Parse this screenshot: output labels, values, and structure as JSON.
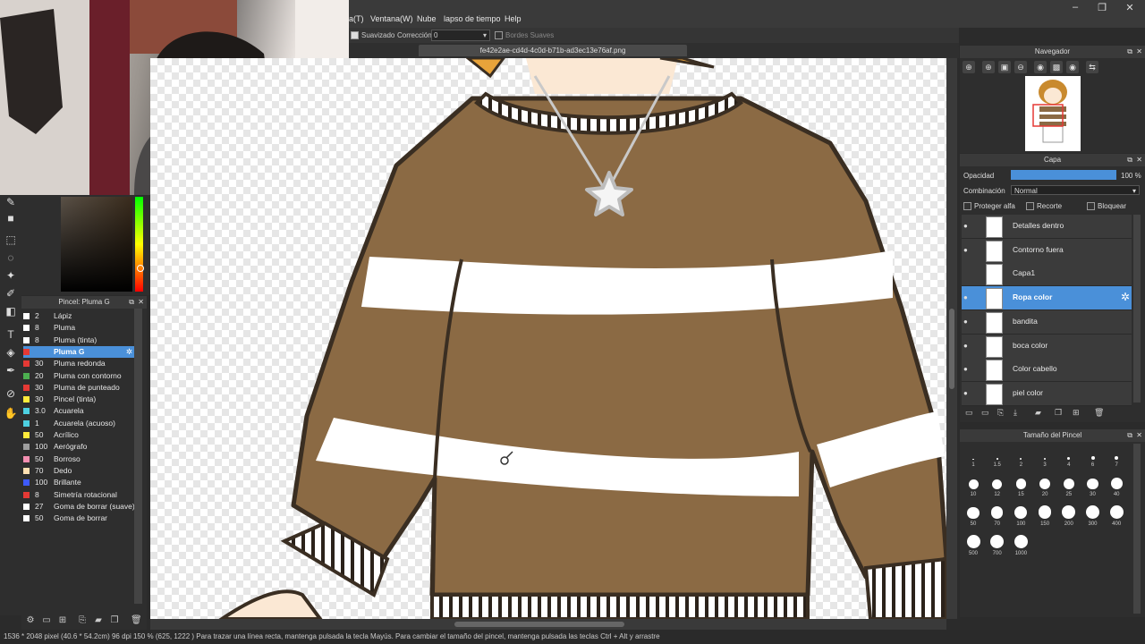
{
  "menu": {
    "items": [
      "a(T)",
      "Ventana(W)",
      "Nube",
      "lapso de tiempo",
      "Help"
    ]
  },
  "window_controls": {
    "minimize": "–",
    "restore": "❐",
    "close": "✕"
  },
  "tool_options": {
    "smoothing_label": "Suavizado",
    "correction_label": "Corrección",
    "correction_value": "0",
    "soft_edges_label": "Bordes Suaves"
  },
  "document": {
    "tab_title": "fe42e2ae-cd4d-4c0d-b71b-ad3ec13e76af.png"
  },
  "brush_panel": {
    "title": "Pincel: Pluma G",
    "brushes": [
      {
        "size": "2",
        "name": "Lápiz",
        "color": "#ffffff"
      },
      {
        "size": "8",
        "name": "Pluma",
        "color": "#ffffff"
      },
      {
        "size": "8",
        "name": "Pluma (tinta)",
        "color": "#ffffff"
      },
      {
        "size": "",
        "name": "Pluma G",
        "color": "#e53935"
      },
      {
        "size": "30",
        "name": "Pluma redonda",
        "color": "#e53935"
      },
      {
        "size": "20",
        "name": "Pluma con contorno",
        "color": "#4caf50"
      },
      {
        "size": "30",
        "name": "Pluma de punteado",
        "color": "#e53935"
      },
      {
        "size": "30",
        "name": "Pincel (tinta)",
        "color": "#ffeb3b"
      },
      {
        "size": "3.0",
        "name": "Acuarela",
        "color": "#4dd0e1"
      },
      {
        "size": "1",
        "name": "Acuarela (acuoso)",
        "color": "#4dd0e1"
      },
      {
        "size": "50",
        "name": "Acrílico",
        "color": "#ffeb3b"
      },
      {
        "size": "100",
        "name": "Aerógrafo",
        "color": "#9e9e9e"
      },
      {
        "size": "50",
        "name": "Borroso",
        "color": "#f48fb1"
      },
      {
        "size": "70",
        "name": "Dedo",
        "color": "#ffe0b2"
      },
      {
        "size": "100",
        "name": "Brillante",
        "color": "#3d5afe"
      },
      {
        "size": "8",
        "name": "Simetría rotacional",
        "color": "#e53935"
      },
      {
        "size": "27",
        "name": "Goma de borrar (suave)",
        "color": "#ffffff"
      },
      {
        "size": "50",
        "name": "Goma de borrar",
        "color": "#ffffff"
      }
    ]
  },
  "navigator": {
    "title": "Navegador"
  },
  "layers": {
    "title": "Capa",
    "opacity_label": "Opacidad",
    "opacity_value": "100 %",
    "opacity_fraction": 1.0,
    "blend_label": "Combinación",
    "blend_value": "Normal",
    "protect_alpha": "Proteger alfa",
    "clipping": "Recorte",
    "lock": "Bloquear",
    "items": [
      {
        "name": "Detalles dentro",
        "visible": true,
        "selected": false
      },
      {
        "name": "Contorno fuera",
        "visible": true,
        "selected": false
      },
      {
        "name": "Capa1",
        "visible": false,
        "selected": false
      },
      {
        "name": "Ropa color",
        "visible": true,
        "selected": true
      },
      {
        "name": "bandita",
        "visible": true,
        "selected": false
      },
      {
        "name": "boca color",
        "visible": true,
        "selected": false
      },
      {
        "name": "Color cabello",
        "visible": true,
        "selected": false
      },
      {
        "name": "piel color",
        "visible": true,
        "selected": false
      }
    ]
  },
  "brush_size": {
    "title": "Tamaño del Pincel",
    "sizes": [
      "1",
      "1.5",
      "2",
      "3",
      "4",
      "6",
      "7",
      "10",
      "12",
      "15",
      "20",
      "25",
      "30",
      "40",
      "50",
      "70",
      "100",
      "150",
      "200",
      "300",
      "400",
      "500",
      "700",
      "1000"
    ]
  },
  "status": {
    "text": "1536 * 2048 pixel   (40.6 * 54.2cm)   96 dpi   150 %   (625, 1222 )   Para trazar una línea recta, mantenga pulsada la tecla Mayús. Para cambiar el tamaño del pincel, mantenga pulsada las teclas Ctrl + Alt y arrastre"
  },
  "colors": {
    "accent": "#4a90d9",
    "sweater": "#8b6a44",
    "outline": "#3a2e22",
    "stripe": "#ffffff"
  }
}
